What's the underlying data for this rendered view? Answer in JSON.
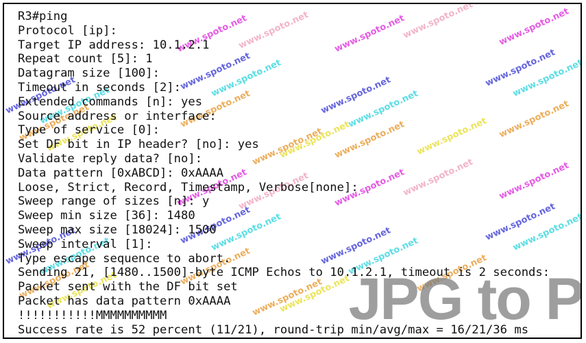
{
  "console": {
    "lines": [
      "R3#ping",
      "Protocol [ip]:",
      "Target IP address: 10.1.2.1",
      "Repeat count [5]: 1",
      "Datagram size [100]:",
      "Timeout in seconds [2]:",
      "Extended commands [n]: yes",
      "Source address or interface:",
      "Type of service [0]:",
      "Set DF bit in IP header? [no]: yes",
      "Validate reply data? [no]:",
      "Data pattern [0xABCD]: 0xAAAA",
      "Loose, Strict, Record, Timestamp, Verbose[none]:",
      "Sweep range of sizes [n]: y",
      "Sweep min size [36]: 1480",
      "Sweep max size [18024]: 1500",
      "Sweep interval [1]:",
      "Type escape sequence to abort.",
      "Sending 21, [1480..1500]-byte ICMP Echos to 10.1.2.1, timeout is 2 seconds:",
      "Packet sent with the DF bit set",
      "Packet has data pattern 0xAAAA",
      "!!!!!!!!!!!MMMMMMMMMM",
      "Success rate is 52 percent (11/21), round-trip min/avg/max = 16/21/36 ms"
    ]
  },
  "watermark": {
    "text": "www.spoto.net"
  },
  "overlay": {
    "text": "JPG to P"
  },
  "colors": {
    "text": "#111111",
    "background": "#ffffff",
    "border": "#000000",
    "watermark_blue": "#4b4bd8",
    "watermark_magenta": "#e040e0",
    "watermark_pink": "#f0a8c0",
    "watermark_cyan": "#40d8e0",
    "watermark_orange": "#e8a040",
    "watermark_yellow": "#e8e040",
    "overlay_gray": "#787878"
  }
}
